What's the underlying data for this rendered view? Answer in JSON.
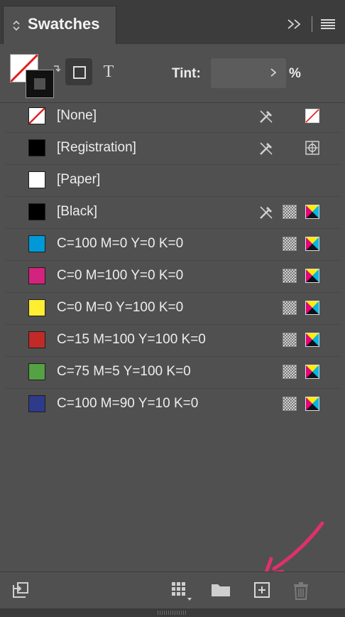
{
  "panel": {
    "title": "Swatches"
  },
  "tint": {
    "label": "Tint:",
    "value": "",
    "unit": "%"
  },
  "swatches": [
    {
      "name": "[None]",
      "color": "none",
      "locked": true,
      "mode": "none"
    },
    {
      "name": "[Registration]",
      "color": "#000000",
      "locked": true,
      "mode": "registration"
    },
    {
      "name": "[Paper]",
      "color": "#ffffff",
      "locked": false,
      "mode": ""
    },
    {
      "name": "[Black]",
      "color": "#000000",
      "locked": true,
      "mode": "process-cmyk"
    },
    {
      "name": "C=100 M=0 Y=0 K=0",
      "color": "#0099d8",
      "locked": false,
      "mode": "process-cmyk"
    },
    {
      "name": "C=0 M=100 Y=0 K=0",
      "color": "#d4237e",
      "locked": false,
      "mode": "process-cmyk"
    },
    {
      "name": "C=0 M=0 Y=100 K=0",
      "color": "#ffee32",
      "locked": false,
      "mode": "process-cmyk"
    },
    {
      "name": "C=15 M=100 Y=100 K=0",
      "color": "#c12a27",
      "locked": false,
      "mode": "process-cmyk"
    },
    {
      "name": "C=75 M=5 Y=100 K=0",
      "color": "#55a244",
      "locked": false,
      "mode": "process-cmyk"
    },
    {
      "name": "C=100 M=90 Y=10 K=0",
      "color": "#2e3a8a",
      "locked": false,
      "mode": "process-cmyk"
    }
  ],
  "colors": {
    "panel_bg": "#505050",
    "annotation_arrow": "#e0306a"
  }
}
